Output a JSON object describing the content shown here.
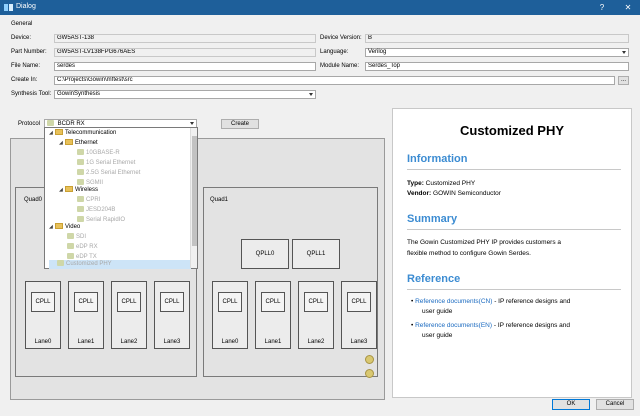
{
  "window": {
    "title": "Dialog",
    "help_glyph": "?",
    "close_glyph": "✕"
  },
  "general": {
    "section_label": "General",
    "device_label": "Device:",
    "device_value": "GW5AST-138",
    "device_version_label": "Device Version:",
    "device_version_value": "B",
    "part_number_label": "Part Number:",
    "part_number_value": "GW5AST-LV138FPG676AES",
    "language_label": "Language:",
    "language_value": "Verilog",
    "file_name_label": "File Name:",
    "file_name_value": "serdes",
    "module_name_label": "Module Name:",
    "module_name_value": "Serdes_Top",
    "create_in_label": "Create In:",
    "create_in_value": "C:\\Projects\\Gowin\\mftest\\src",
    "browse_label": "...",
    "synthesis_tool_label": "Synthesis Tool:",
    "synthesis_tool_value": "GowinSynthesis"
  },
  "protocol": {
    "label": "Protocol",
    "value": "BCDR RX",
    "create_label": "Create",
    "tree": [
      {
        "kind": "folder",
        "label": "Telecommunication"
      },
      {
        "kind": "folder",
        "label": "Ethernet"
      },
      {
        "kind": "item",
        "label": "10GBASE-R"
      },
      {
        "kind": "item",
        "label": "1G Serial Ethernet"
      },
      {
        "kind": "item",
        "label": "2.5G Serial Ethernet"
      },
      {
        "kind": "item",
        "label": "SGMII"
      },
      {
        "kind": "folder",
        "label": "Wireless"
      },
      {
        "kind": "item",
        "label": "CPRI"
      },
      {
        "kind": "item",
        "label": "JESD204B"
      },
      {
        "kind": "item",
        "label": "Serial RapidIO"
      },
      {
        "kind": "folder",
        "label": "Video"
      },
      {
        "kind": "item",
        "label": "SDI"
      },
      {
        "kind": "item",
        "label": "eDP RX"
      },
      {
        "kind": "item",
        "label": "eDP TX"
      },
      {
        "kind": "item",
        "label": "Customized PHY"
      }
    ]
  },
  "diagram": {
    "quad0": {
      "title": "Quad0",
      "lanes": [
        {
          "cpll": "CPLL",
          "label": "Lane0"
        },
        {
          "cpll": "CPLL",
          "label": "Lane1"
        },
        {
          "cpll": "CPLL",
          "label": "Lane2"
        },
        {
          "cpll": "CPLL",
          "label": "Lane3"
        }
      ]
    },
    "quad1": {
      "title": "Quad1",
      "qpll0": "QPLL0",
      "qpll1": "QPLL1",
      "lanes": [
        {
          "cpll": "CPLL",
          "label": "Lane0"
        },
        {
          "cpll": "CPLL",
          "label": "Lane1"
        },
        {
          "cpll": "CPLL",
          "label": "Lane2"
        },
        {
          "cpll": "CPLL",
          "label": "Lane3"
        }
      ]
    }
  },
  "info": {
    "title": "Customized PHY",
    "information_heading": "Information",
    "type_label": "Type:",
    "type_value": "Customized PHY",
    "vendor_label": "Vendor:",
    "vendor_value": "GOWIN Semiconductor",
    "summary_heading": "Summary",
    "summary_line1": "The Gowin Customized PHY IP provides customers a",
    "summary_line2": "flexible method to configure Gowin Serdes.",
    "reference_heading": "Reference",
    "ref1_link": "Reference documents(CN)",
    "ref1_rest": " - IP reference designs and",
    "ref1_cont": "user guide",
    "ref2_link": "Reference documents(EN)",
    "ref2_rest": " - IP reference designs and",
    "ref2_cont": "user guide"
  },
  "footer": {
    "ok_label": "OK",
    "cancel_label": "Cancel"
  },
  "colors": {
    "titlebar": "#1e5f9a",
    "heading": "#3c8cd2",
    "link": "#1a6ac0"
  }
}
